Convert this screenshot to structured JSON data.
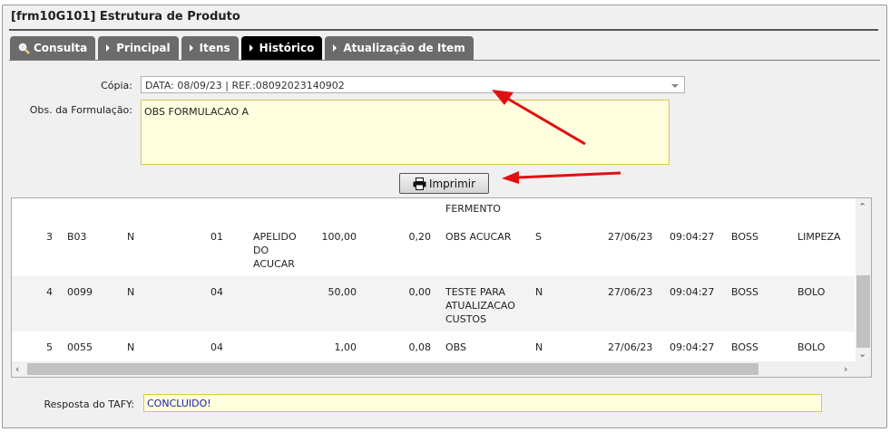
{
  "window": {
    "title": "[frm10G101] Estrutura de Produto"
  },
  "tabs": [
    {
      "label": "Consulta",
      "icon": "search-icon"
    },
    {
      "label": "Principal",
      "icon": "caret-right-icon"
    },
    {
      "label": "Itens",
      "icon": "caret-right-icon"
    },
    {
      "label": "Histórico",
      "icon": "caret-right-icon",
      "active": true
    },
    {
      "label": "Atualização de Item",
      "icon": "caret-right-icon"
    }
  ],
  "form": {
    "copia_label": "Cópia:",
    "copia_value": "DATA: 08/09/23 | REF.:08092023140902",
    "obs_label": "Obs. da Formulação:",
    "obs_value": "OBS FORMULACAO A",
    "print_label": "Imprimir",
    "resposta_label": "Resposta do TAFY:",
    "resposta_value": "CONCLUIDO!"
  },
  "grid": {
    "partial_top": "FERMENTO",
    "rows": [
      {
        "seq": "3",
        "code": "B03",
        "flag": "N",
        "grp": "01",
        "apelido": [
          "APELIDO",
          "DO",
          "ACUCAR"
        ],
        "qty": "100,00",
        "val": "0,20",
        "obs": [
          "OBS ACUCAR"
        ],
        "s": "S",
        "date": "27/06/23",
        "time": "09:04:27",
        "user": "BOSS",
        "cat": "LIMPEZA"
      },
      {
        "seq": "4",
        "code": "0099",
        "flag": "N",
        "grp": "04",
        "apelido": [],
        "qty": "50,00",
        "val": "0,00",
        "obs": [
          "TESTE PARA",
          "ATUALIZACAO",
          "CUSTOS"
        ],
        "s": "N",
        "date": "27/06/23",
        "time": "09:04:27",
        "user": "BOSS",
        "cat": "BOLO"
      },
      {
        "seq": "5",
        "code": "0055",
        "flag": "N",
        "grp": "04",
        "apelido": [],
        "qty": "1,00",
        "val": "0,08",
        "obs": [
          "OBS"
        ],
        "s": "N",
        "date": "27/06/23",
        "time": "09:04:27",
        "user": "BOSS",
        "cat": "BOLO"
      }
    ]
  },
  "colors": {
    "active_tab": "#000000",
    "tab": "#6b6b6b",
    "highlight_field": "#ffffe0",
    "annotation_arrow": "#e01010"
  }
}
